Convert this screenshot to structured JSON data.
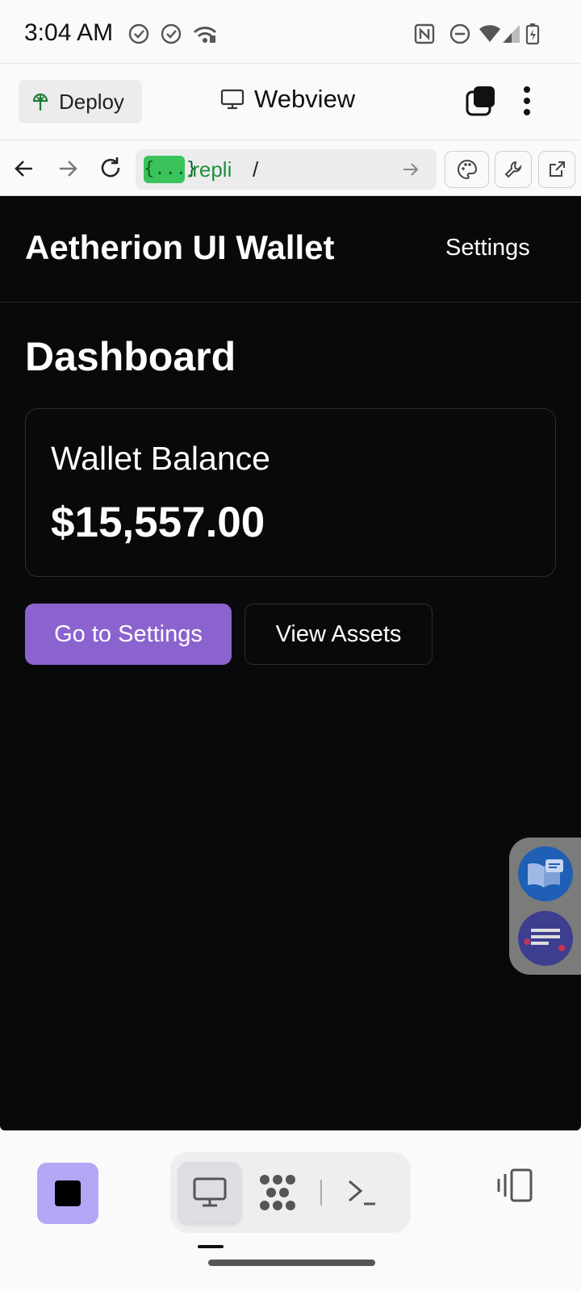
{
  "status_bar": {
    "time": "3:04 AM",
    "icons": [
      "check-circle-icon",
      "check-circle-icon",
      "wifi-calling-icon",
      "nfc-icon",
      "dnd-icon",
      "wifi-icon",
      "signal-icon",
      "battery-charging-icon"
    ]
  },
  "header": {
    "deploy_label": "Deploy",
    "title": "Webview"
  },
  "url_bar": {
    "badge": "{...}",
    "host": ".repli",
    "path": "/"
  },
  "web": {
    "brand": "Aetherion UI Wallet",
    "nav_settings": "Settings",
    "page_title": "Dashboard",
    "balance_label": "Wallet Balance",
    "balance_value": "$15,557.00",
    "primary_button": "Go to Settings",
    "secondary_button": "View Assets"
  },
  "colors": {
    "accent": "#8b63cf",
    "background": "#09090b",
    "url_badge": "#3ac35a",
    "stop_button": "#b4a6f5"
  }
}
